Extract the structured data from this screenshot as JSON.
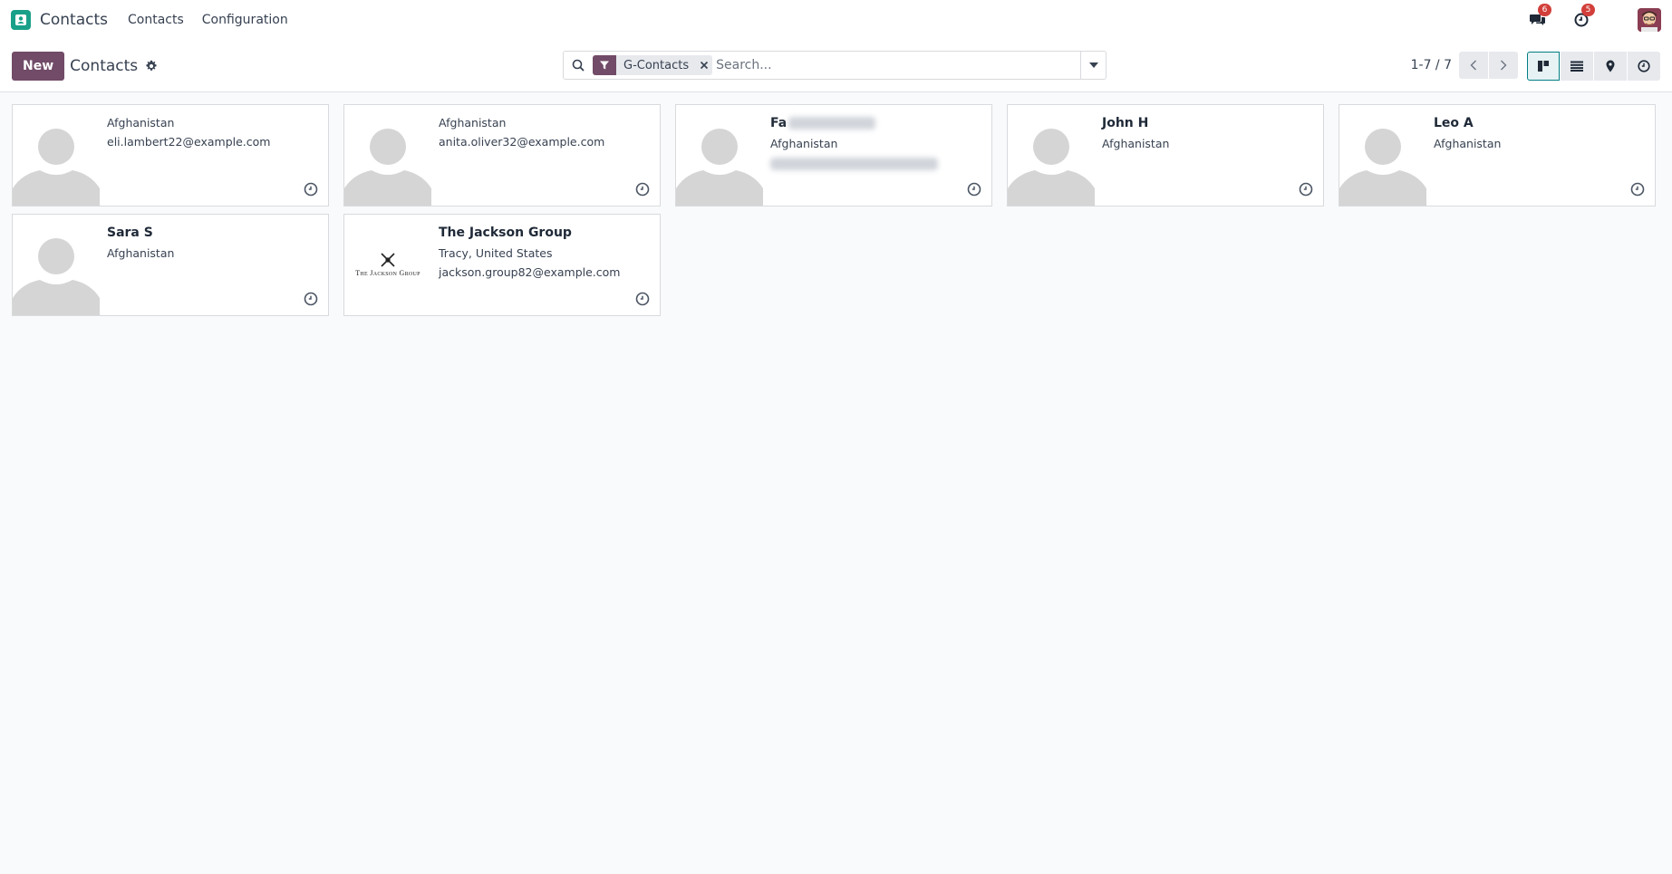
{
  "navbar": {
    "app_name": "Contacts",
    "menus": [
      "Contacts",
      "Configuration"
    ],
    "messages_badge": "6",
    "activities_badge": "5"
  },
  "control_panel": {
    "new_label": "New",
    "title": "Contacts",
    "search": {
      "facet_label": "G-Contacts",
      "placeholder": "Search..."
    },
    "pager": {
      "value": "1-7 / 7"
    }
  },
  "cards": [
    {
      "name": "",
      "line1": "Afghanistan",
      "line2": "eli.lambert22@example.com",
      "image": "avatar-placeholder"
    },
    {
      "name": "",
      "line1": "Afghanistan",
      "line2": "anita.oliver32@example.com",
      "image": "avatar-placeholder"
    },
    {
      "name": "Fa",
      "line1": "Afghanistan",
      "line2": "",
      "image": "avatar-placeholder",
      "blurred": true
    },
    {
      "name": "John H",
      "line1": "Afghanistan",
      "line2": "",
      "image": "avatar-placeholder"
    },
    {
      "name": "Leo A",
      "line1": "Afghanistan",
      "line2": "",
      "image": "avatar-placeholder"
    },
    {
      "name": "Sara S",
      "line1": "Afghanistan",
      "line2": "",
      "image": "avatar-placeholder"
    },
    {
      "name": "The Jackson Group",
      "line1": "Tracy, United States",
      "line2": "jackson.group82@example.com",
      "image": "company-logo",
      "logo_text": "The Jackson Group"
    }
  ],
  "colors": {
    "brand": "#714b67",
    "app_icon": "#1aa089",
    "badge": "#d23f3a",
    "active_view": "#017e84"
  }
}
